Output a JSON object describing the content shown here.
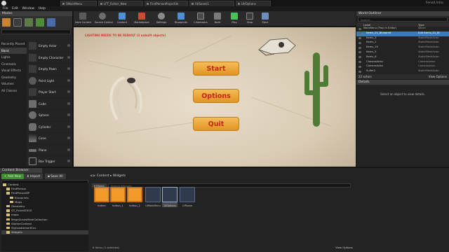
{
  "title_bar": {
    "tabs": [
      "SMainMenu",
      "LFT_Fullscr_New",
      "FirstPersonProjectile",
      "UI/Saves1",
      "UI/Options"
    ],
    "project_name": "Fenall.Intro"
  },
  "menu": [
    "File",
    "Edit",
    "Window",
    "Help"
  ],
  "modes": {
    "tab_label": "Modes",
    "search_placeholder": "",
    "categories": [
      "Recently Placed",
      "Basic",
      "Lights",
      "Cinematic",
      "Visual Effects",
      "Geometry",
      "Volumes",
      "All Classes"
    ],
    "active_category": "Basic",
    "actors": [
      "Empty Actor",
      "Empty Character",
      "Empty Pawn",
      "Point Light",
      "Player Start",
      "Cube",
      "Sphere",
      "Cylinder",
      "Cone",
      "Plane",
      "Box Trigger",
      "Sphere Trigger"
    ]
  },
  "toolbar": {
    "buttons": [
      "Save Current",
      "Source Control",
      "Content",
      "Marketplace",
      "Settings",
      "Blueprints",
      "Cinematics",
      "Build",
      "Play",
      "Stop",
      "Eject"
    ],
    "accent_colors": [
      "#4c8fd6",
      "#d04a2f",
      "#d8b93a",
      "#4ac25a"
    ]
  },
  "viewport": {
    "warning": "LIGHTING NEEDS TO BE REBUILT (3 unbuilt objects)",
    "menu_buttons": [
      "Start",
      "Options",
      "Quit"
    ],
    "button_color": "#f0a43a",
    "button_text_color": "#c4271a"
  },
  "world_outliner": {
    "tab_label": "World Outliner",
    "search_placeholder": "Search...",
    "col_label": "Label",
    "col_type": "Type",
    "rows": [
      {
        "label": "MainMenu (Play In Editor)",
        "type": "World"
      },
      {
        "label": "Items_01_Blueprint",
        "type": "Edit Items_01_Bl"
      },
      {
        "label": "Items_3",
        "type": "StaticMeshActor"
      },
      {
        "label": "Items_2",
        "type": "StaticMeshActor"
      },
      {
        "label": "Items_10",
        "type": "StaticMeshActor"
      },
      {
        "label": "Items_5",
        "type": "StaticMeshActor"
      },
      {
        "label": "Items_6",
        "type": "StaticMeshActor"
      },
      {
        "label": "CameraActor",
        "type": "CameraActor"
      },
      {
        "label": "CameraActor",
        "type": "CameraActor"
      },
      {
        "label": "Sulfer2",
        "type": "StaticMeshActor"
      }
    ],
    "footer_count": "22 actors",
    "footer_options": "View Options"
  },
  "details": {
    "tab_label": "Details",
    "empty_message": "Select an object to view details."
  },
  "content_browser": {
    "tab_label": "Content Browser",
    "add_new": "Add New",
    "import": "Import",
    "save_all": "Save All",
    "path": [
      "Content",
      "Widgets"
    ],
    "filters_label": "Filters",
    "search_placeholder": "Search Widgets",
    "search_paths_placeholder": "Search Folders",
    "folders": [
      {
        "name": "Content",
        "level": 0
      },
      {
        "name": "FirstPerson",
        "level": 1
      },
      {
        "name": "FirstPersonBP",
        "level": 1
      },
      {
        "name": "Blueprints",
        "level": 2
      },
      {
        "name": "Maps",
        "level": 2
      },
      {
        "name": "Geometry",
        "level": 1
      },
      {
        "name": "GT_Forest2010",
        "level": 1
      },
      {
        "name": "maps",
        "level": 1
      },
      {
        "name": "MegaScansMeshCollection",
        "level": 1
      },
      {
        "name": "StarterContent",
        "level": 1
      },
      {
        "name": "StylizedDesertEnv",
        "level": 1
      },
      {
        "name": "Widgets",
        "level": 1
      }
    ],
    "assets": [
      "button",
      "button_1",
      "button_2",
      "UIMainMenu",
      "UIOptions",
      "UIPause"
    ],
    "selected_asset": "UIOptions",
    "status": "6 items (1 selected)",
    "view_options": "View Options"
  }
}
